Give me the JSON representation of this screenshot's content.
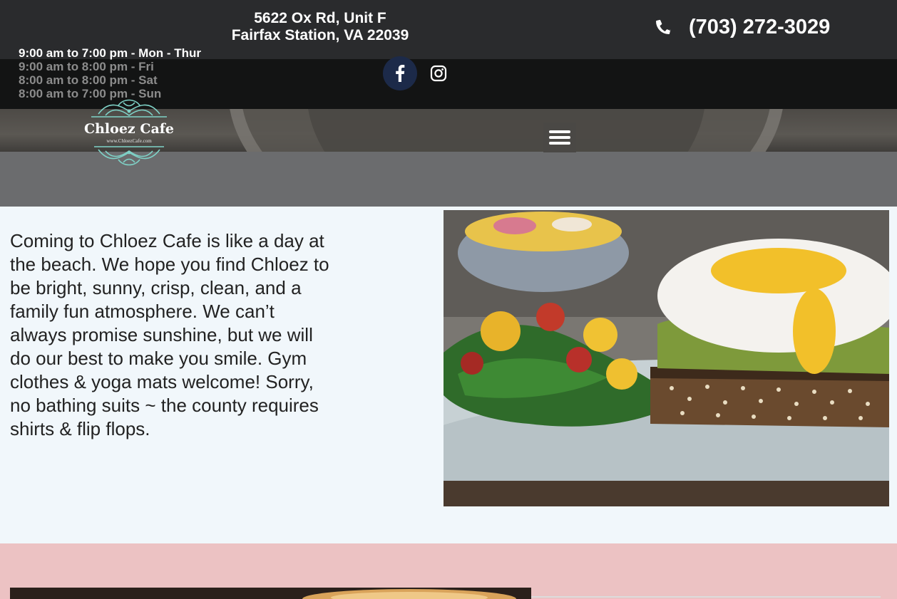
{
  "header": {
    "address_line1": "5622 Ox Rd, Unit F",
    "address_line2": "Fairfax Station, VA 22039",
    "phone": "(703) 272-3029",
    "hours": [
      {
        "text": "9:00 am to 7:00 pm - Mon - Thur",
        "active": true
      },
      {
        "text": "9:00 am to 8:00 pm - Fri",
        "active": false
      },
      {
        "text": "8:00 am to 8:00 pm - Sat",
        "active": false
      },
      {
        "text": "8:00 am to 7:00 pm - Sun",
        "active": false
      }
    ],
    "logo_text": "Chloez Cafe",
    "logo_url": "www.ChloezCafe.com",
    "icons": {
      "phone": "phone-icon",
      "facebook": "facebook-icon",
      "instagram": "instagram-icon",
      "menu": "hamburger-menu-icon"
    }
  },
  "about": {
    "text": "Coming to Chloez Cafe is like a day at the beach. We hope you find Chloez to be bright, sunny, crisp, clean, and a family fun atmosphere. We can’t always promise sunshine, but we will do our best to make you smile. Gym clothes & yoga mats welcome! Sorry, no bathing suits ~ the county requires shirts & flip flops."
  },
  "colors": {
    "topbar": "#2a2b2d",
    "darkband": "#131414",
    "header_bg": "#6b6c6e",
    "about_bg": "#f1f7fb",
    "pink_bg": "#ecc2c3",
    "logo_teal": "#7fd3c8",
    "facebook_circle": "#1c2a49"
  }
}
